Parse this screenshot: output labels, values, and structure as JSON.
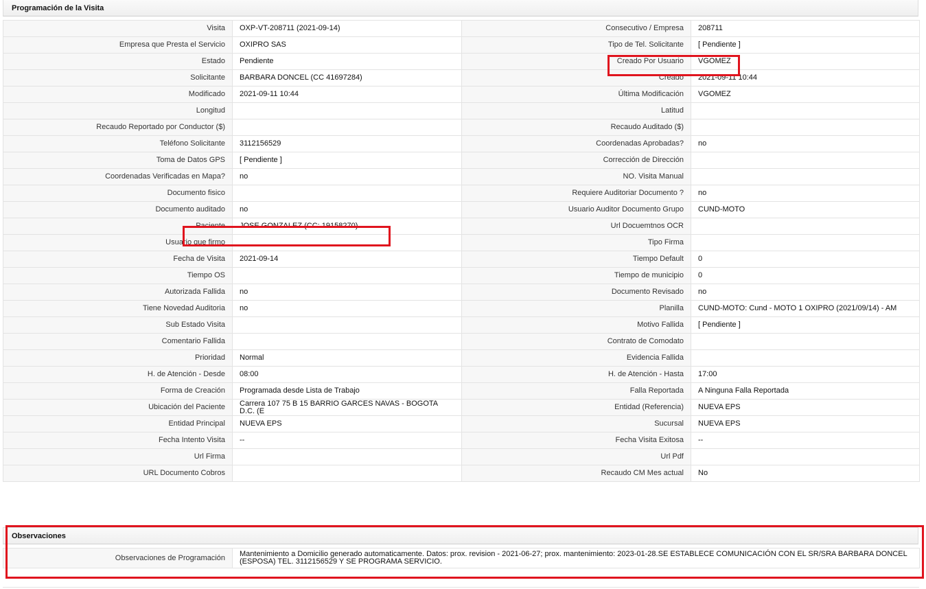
{
  "sections": {
    "programacion_title": "Programación de la Visita",
    "observaciones_title": "Observaciones"
  },
  "rows": [
    {
      "l1": "Visita",
      "v1": "OXP-VT-208711 (2021-09-14)",
      "l2": "Consecutivo / Empresa",
      "v2": "208711"
    },
    {
      "l1": "Empresa que Presta el Servicio",
      "v1": "OXIPRO SAS",
      "l2": "Tipo de Tel. Solicitante",
      "v2": "[ Pendiente ]"
    },
    {
      "l1": "Estado",
      "v1": "Pendiente",
      "l2": "Creado Por Usuario",
      "v2": "VGOMEZ"
    },
    {
      "l1": "Solicitante",
      "v1": "BARBARA DONCEL (CC 41697284)",
      "l2": "Creado",
      "v2": "2021-09-11 10:44"
    },
    {
      "l1": "Modificado",
      "v1": "2021-09-11 10:44",
      "l2": "Última Modificación",
      "v2": " VGOMEZ"
    },
    {
      "l1": "Longitud",
      "v1": "",
      "l2": "Latitud",
      "v2": ""
    },
    {
      "l1": "Recaudo Reportado por Conductor ($)",
      "v1": "",
      "l2": "Recaudo Auditado ($)",
      "v2": ""
    },
    {
      "l1": "Teléfono Solicitante",
      "v1": "3112156529",
      "l2": "Coordenadas Aprobadas?",
      "v2": " no"
    },
    {
      "l1": "Toma de Datos GPS",
      "v1": "[ Pendiente ]",
      "l2": "Corrección de Dirección",
      "v2": ""
    },
    {
      "l1": "Coordenadas Verificadas en Mapa?",
      "v1": " no",
      "l2": "NO. Visita Manual",
      "v2": ""
    },
    {
      "l1": "Documento fisico",
      "v1": "",
      "l2": "Requiere Auditoriar Documento ?",
      "v2": " no"
    },
    {
      "l1": "Documento auditado",
      "v1": "no",
      "l2": "Usuario Auditor Documento Grupo",
      "v2": "CUND-MOTO"
    },
    {
      "l1": "Paciente",
      "v1": "JOSE GONZALEZ (CC: 19158270)",
      "l2": "Url Docuemtnos OCR",
      "v2": ""
    },
    {
      "l1": "Usuario que firmo",
      "v1": "",
      "l2": "Tipo Firma",
      "v2": ""
    },
    {
      "l1": "Fecha de Visita",
      "v1": " 2021-09-14",
      "l2": "Tiempo Default",
      "v2": "0"
    },
    {
      "l1": "Tiempo OS",
      "v1": "",
      "l2": "Tiempo de municipio",
      "v2": "0"
    },
    {
      "l1": "Autorizada Fallida",
      "v1": "no",
      "l2": "Documento Revisado",
      "v2": " no"
    },
    {
      "l1": "Tiene Novedad Auditoria",
      "v1": "no",
      "l2": "Planilla",
      "v2": "CUND-MOTO: Cund - MOTO 1 OXIPRO (2021/09/14) - AM"
    },
    {
      "l1": "Sub Estado Visita",
      "v1": "",
      "l2": "Motivo Fallida",
      "v2": "[ Pendiente ]"
    },
    {
      "l1": "Comentario Fallida",
      "v1": "",
      "l2": "Contrato de Comodato",
      "v2": ""
    },
    {
      "l1": "Prioridad",
      "v1": "Normal",
      "l2": "Evidencia Fallida",
      "v2": ""
    },
    {
      "l1": "H. de Atención - Desde",
      "v1": "08:00",
      "l2": "H. de Atención - Hasta",
      "v2": "17:00"
    },
    {
      "l1": "Forma de Creación",
      "v1": "Programada desde Lista de Trabajo",
      "l2": "Falla Reportada",
      "v2": "A Ninguna Falla Reportada"
    },
    {
      "l1": "Ubicación del Paciente",
      "v1": "Carrera 107 75 B 15 BARRIO GARCES NAVAS - BOGOTA D.C. (E",
      "l2": "Entidad (Referencia)",
      "v2": "NUEVA EPS"
    },
    {
      "l1": "Entidad Principal",
      "v1": "NUEVA EPS",
      "l2": "Sucursal",
      "v2": "NUEVA EPS"
    },
    {
      "l1": "Fecha Intento Visita",
      "v1": " --",
      "l2": "Fecha Visita Exitosa",
      "v2": " --"
    },
    {
      "l1": "Url Firma",
      "v1": "",
      "l2": "Url Pdf",
      "v2": ""
    },
    {
      "l1": "URL Documento Cobros",
      "v1": "",
      "l2": "Recaudo CM Mes actual",
      "v2": "No"
    }
  ],
  "observaciones": {
    "label": "Observaciones de Programación",
    "value": "  Mantenimiento a Domicilio generado automaticamente. Datos: prox. revision - 2021-06-27; prox. mantenimiento: 2023-01-28.SE ESTABLECE COMUNICACIÓN CON EL SR/SRA BARBARA DONCEL (ESPOSA) TEL. 3112156529 Y SE PROGRAMA SERVICIO."
  },
  "highlight_color": "#e0141e"
}
